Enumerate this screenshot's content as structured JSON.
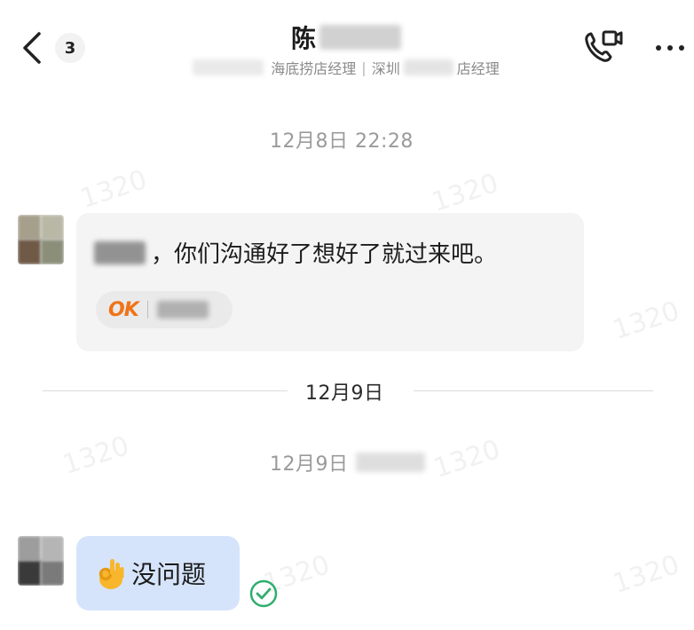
{
  "header": {
    "unread_count": "3",
    "contact_name_prefix": "陈",
    "subtitle_part1": "海底捞店经理",
    "subtitle_separator": "|",
    "subtitle_part2": "深圳",
    "subtitle_part3": "店经理"
  },
  "messages": {
    "timestamp_1": "12月8日 22:28",
    "message_1_text": "，你们沟通好了想好了就过来吧。",
    "reaction_label": "OK",
    "date_divider": "12月9日",
    "timestamp_2": "12月9日",
    "message_2_text": "没问题"
  },
  "watermark": {
    "text": "1320"
  },
  "colors": {
    "incoming_bubble": "#f4f4f4",
    "outgoing_bubble": "#d6e4fb",
    "read_check": "#2fae6f",
    "reaction_ok": "#f07318"
  }
}
